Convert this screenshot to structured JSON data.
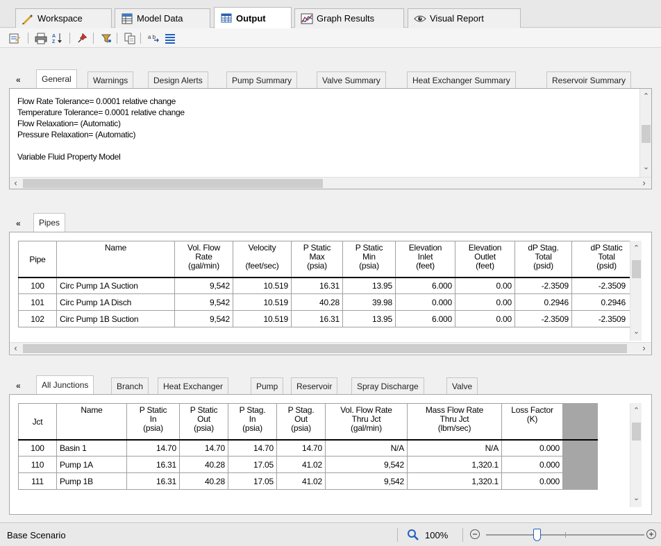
{
  "top_tabs": [
    {
      "label": "Workspace"
    },
    {
      "label": "Model Data"
    },
    {
      "label": "Output"
    },
    {
      "label": "Graph Results"
    },
    {
      "label": "Visual Report"
    }
  ],
  "general": {
    "collapse_glyph": "«",
    "tabs": [
      "General",
      "Warnings",
      "Design Alerts",
      "Pump Summary",
      "Valve Summary",
      "Heat Exchanger Summary",
      "Reservoir Summary"
    ],
    "lines": [
      "Flow Rate Tolerance= 0.0001 relative change",
      "Temperature Tolerance= 0.0001 relative change",
      "Flow Relaxation= (Automatic)",
      "Pressure Relaxation= (Automatic)",
      "",
      "Variable Fluid Property Model"
    ]
  },
  "pipes": {
    "tab": "Pipes",
    "columns": [
      {
        "l1": "Pipe",
        "l2": "",
        "l3": ""
      },
      {
        "l1": "Name",
        "l2": "",
        "l3": ""
      },
      {
        "l1": "Vol. Flow",
        "l2": "Rate",
        "l3": "(gal/min)"
      },
      {
        "l1": "Velocity",
        "l2": "",
        "l3": "(feet/sec)"
      },
      {
        "l1": "P Static",
        "l2": "Max",
        "l3": "(psia)"
      },
      {
        "l1": "P Static",
        "l2": "Min",
        "l3": "(psia)"
      },
      {
        "l1": "Elevation",
        "l2": "Inlet",
        "l3": "(feet)"
      },
      {
        "l1": "Elevation",
        "l2": "Outlet",
        "l3": "(feet)"
      },
      {
        "l1": "dP Stag.",
        "l2": "Total",
        "l3": "(psid)"
      },
      {
        "l1": "dP Static",
        "l2": "Total",
        "l3": "(psid)"
      }
    ],
    "rows": [
      [
        "100",
        "Circ Pump 1A Suction",
        "9,542",
        "10.519",
        "16.31",
        "13.95",
        "6.000",
        "0.00",
        "-2.3509",
        "-2.3509"
      ],
      [
        "101",
        "Circ Pump 1A Disch",
        "9,542",
        "10.519",
        "40.28",
        "39.98",
        "0.000",
        "0.00",
        "0.2946",
        "0.2946"
      ],
      [
        "102",
        "Circ Pump 1B Suction",
        "9,542",
        "10.519",
        "16.31",
        "13.95",
        "6.000",
        "0.00",
        "-2.3509",
        "-2.3509"
      ]
    ]
  },
  "junctions": {
    "tabs": [
      "All Junctions",
      "Branch",
      "Heat Exchanger",
      "Pump",
      "Reservoir",
      "Spray Discharge",
      "Valve"
    ],
    "columns": [
      {
        "l1": "Jct",
        "l2": "",
        "l3": ""
      },
      {
        "l1": "Name",
        "l2": "",
        "l3": ""
      },
      {
        "l1": "P Static",
        "l2": "In",
        "l3": "(psia)"
      },
      {
        "l1": "P Static",
        "l2": "Out",
        "l3": "(psia)"
      },
      {
        "l1": "P Stag.",
        "l2": "In",
        "l3": "(psia)"
      },
      {
        "l1": "P Stag.",
        "l2": "Out",
        "l3": "(psia)"
      },
      {
        "l1": "Vol. Flow Rate",
        "l2": "Thru Jct",
        "l3": "(gal/min)"
      },
      {
        "l1": "Mass Flow Rate",
        "l2": "Thru Jct",
        "l3": "(lbm/sec)"
      },
      {
        "l1": "Loss Factor",
        "l2": "(K)",
        "l3": ""
      }
    ],
    "rows": [
      [
        "100",
        "Basin 1",
        "14.70",
        "14.70",
        "14.70",
        "14.70",
        "N/A",
        "N/A",
        "0.000"
      ],
      [
        "110",
        "Pump 1A",
        "16.31",
        "40.28",
        "17.05",
        "41.02",
        "9,542",
        "1,320.1",
        "0.000"
      ],
      [
        "111",
        "Pump 1B",
        "16.31",
        "40.28",
        "17.05",
        "41.02",
        "9,542",
        "1,320.1",
        "0.000"
      ]
    ]
  },
  "status": {
    "scenario": "Base Scenario",
    "zoom": "100%",
    "zoom_level_fraction": 0.25
  },
  "colors": {
    "accent_blue": "#1f5fbf",
    "selected_tab_bg": "#ffffff",
    "empty_grid_fill": "#a6a6a6"
  }
}
